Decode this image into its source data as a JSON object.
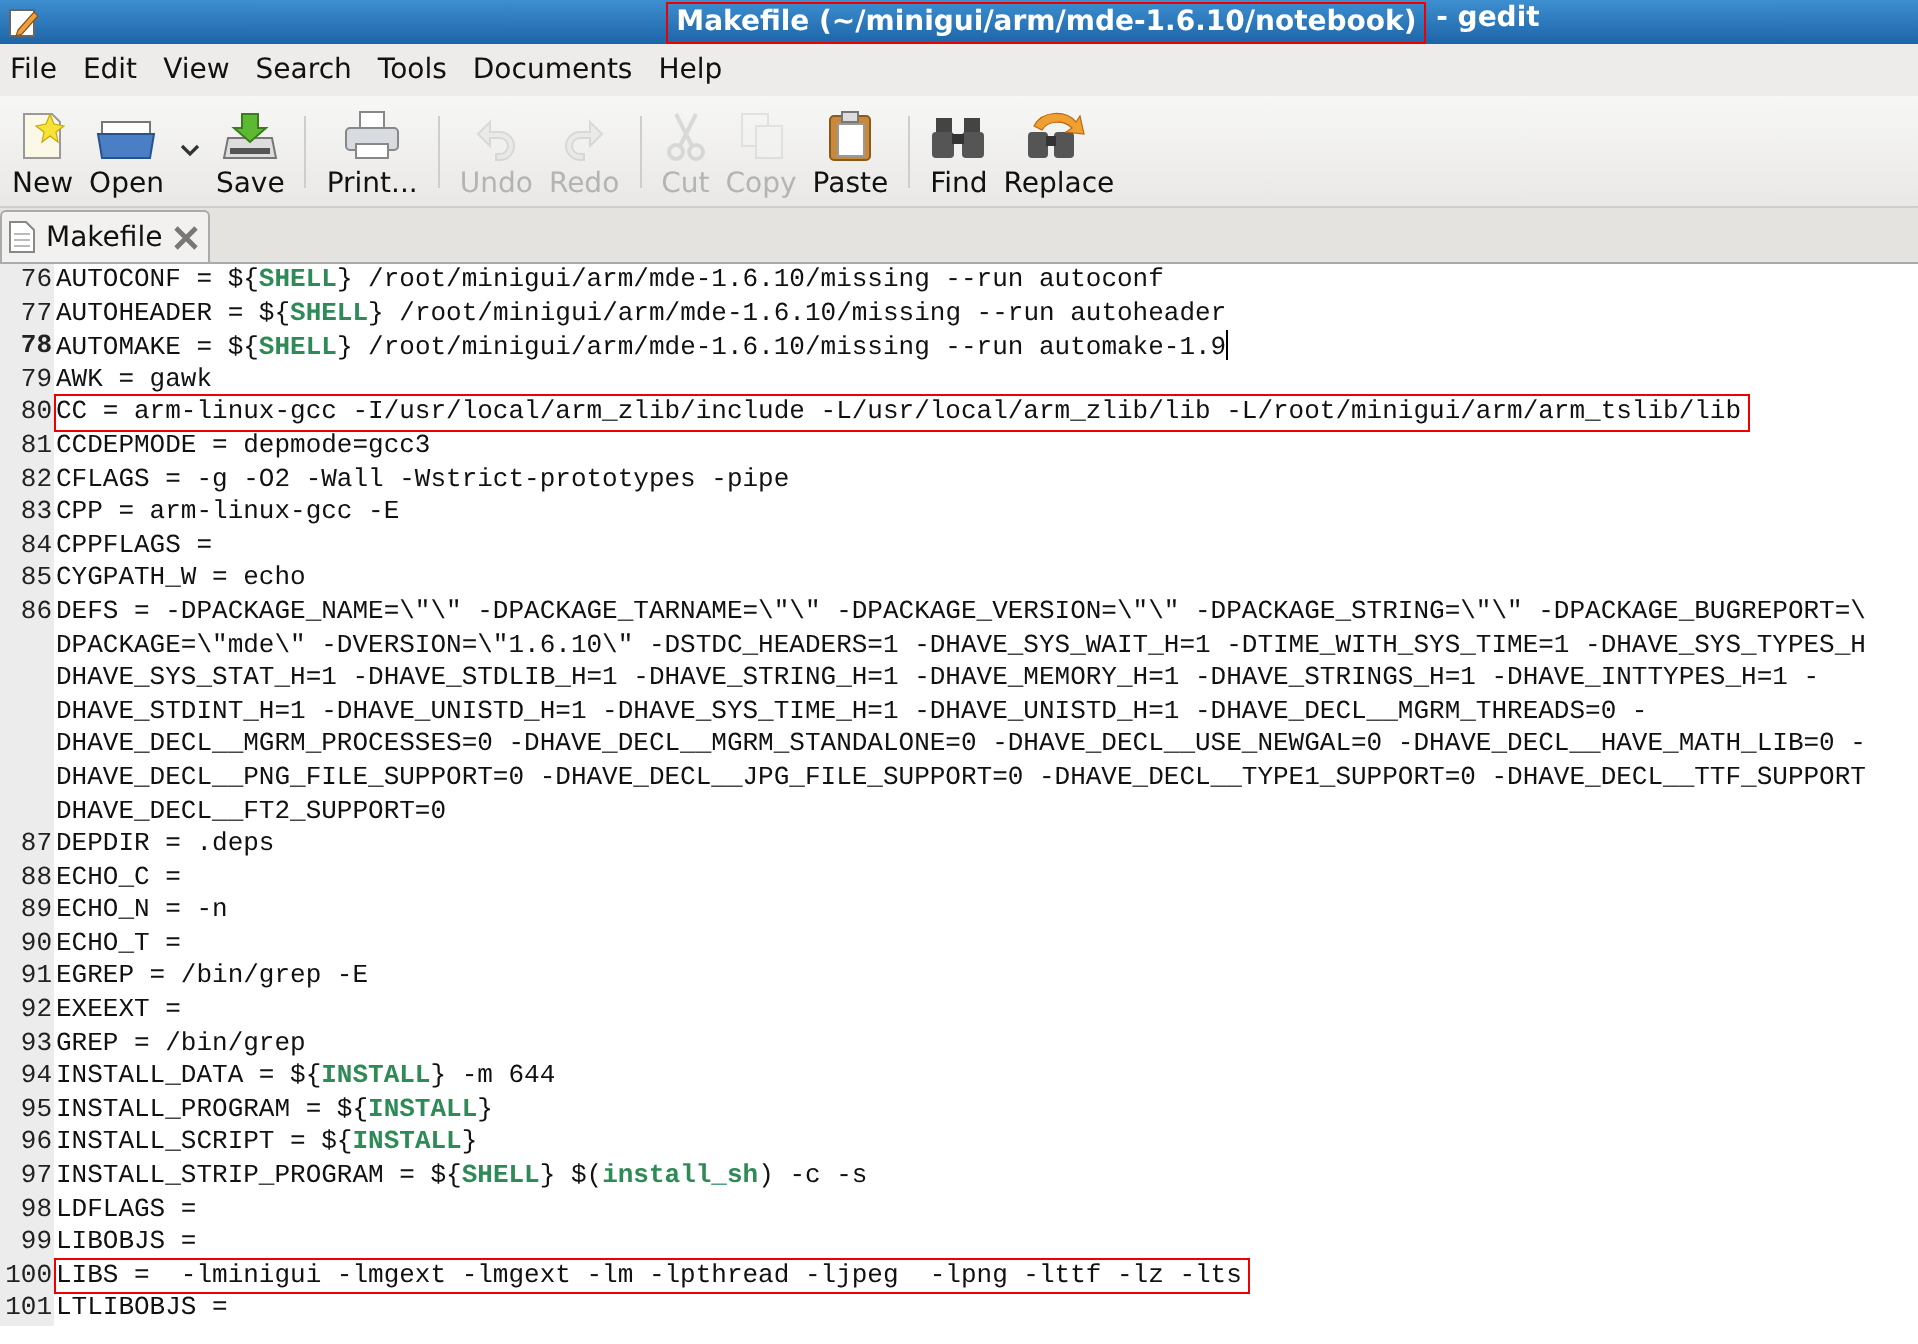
{
  "window": {
    "title": {
      "document": "Makefile (~/minigui/arm/mde-1.6.10/notebook)",
      "app": "- gedit",
      "annotated": true
    }
  },
  "menu": [
    "File",
    "Edit",
    "View",
    "Search",
    "Tools",
    "Documents",
    "Help"
  ],
  "toolbar": [
    {
      "label": "New",
      "kind": "new",
      "disabled": false
    },
    {
      "label": "Open",
      "kind": "open",
      "disabled": false
    },
    {
      "kind": "dropdown",
      "disabled": false
    },
    {
      "label": "Save",
      "kind": "save",
      "disabled": false
    },
    {
      "kind": "separator"
    },
    {
      "label": "Print...",
      "kind": "print",
      "disabled": false
    },
    {
      "kind": "separator"
    },
    {
      "label": "Undo",
      "kind": "undo",
      "disabled": true
    },
    {
      "label": "Redo",
      "kind": "redo",
      "disabled": true
    },
    {
      "kind": "separator"
    },
    {
      "label": "Cut",
      "kind": "cut",
      "disabled": true
    },
    {
      "label": "Copy",
      "kind": "copy",
      "disabled": true
    },
    {
      "label": "Paste",
      "kind": "paste",
      "disabled": false
    },
    {
      "kind": "separator"
    },
    {
      "label": "Find",
      "kind": "find",
      "disabled": false
    },
    {
      "label": "Replace",
      "kind": "replace",
      "disabled": false
    }
  ],
  "tabs": [
    {
      "label": "Makefile",
      "selected": true
    }
  ],
  "editor": {
    "lines": [
      {
        "number": "76",
        "current": false,
        "annotated": false,
        "parts": [
          {
            "text": "AUTOCONF = ${"
          },
          {
            "text": "SHELL",
            "kind": "variable"
          },
          {
            "text": "} /root/minigui/arm/mde-1.6.10/missing --run autoconf"
          }
        ]
      },
      {
        "number": "77",
        "current": false,
        "annotated": false,
        "parts": [
          {
            "text": "AUTOHEADER = ${"
          },
          {
            "text": "SHELL",
            "kind": "variable"
          },
          {
            "text": "} /root/minigui/arm/mde-1.6.10/missing --run autoheader"
          }
        ]
      },
      {
        "number": "78",
        "current": true,
        "annotated": false,
        "parts": [
          {
            "text": "AUTOMAKE = ${"
          },
          {
            "text": "SHELL",
            "kind": "variable"
          },
          {
            "text": "} /root/minigui/arm/mde-1.6.10/missing --run automake-1.9"
          }
        ]
      },
      {
        "number": "79",
        "current": false,
        "annotated": false,
        "parts": [
          {
            "text": "AWK = gawk"
          }
        ]
      },
      {
        "number": "80",
        "current": false,
        "annotated": true,
        "parts": [
          {
            "text": "CC = arm-linux-gcc -I/usr/local/arm_zlib/include -L/usr/local/arm_zlib/lib -L/root/minigui/arm/arm_tslib/lib"
          }
        ]
      },
      {
        "number": "81",
        "current": false,
        "annotated": false,
        "parts": [
          {
            "text": "CCDEPMODE = depmode=gcc3"
          }
        ]
      },
      {
        "number": "82",
        "current": false,
        "annotated": false,
        "parts": [
          {
            "text": "CFLAGS = -g -O2 -Wall -Wstrict-prototypes -pipe"
          }
        ]
      },
      {
        "number": "83",
        "current": false,
        "annotated": false,
        "parts": [
          {
            "text": "CPP = arm-linux-gcc -E"
          }
        ]
      },
      {
        "number": "84",
        "current": false,
        "annotated": false,
        "parts": [
          {
            "text": "CPPFLAGS ="
          }
        ]
      },
      {
        "number": "85",
        "current": false,
        "annotated": false,
        "parts": [
          {
            "text": "CYGPATH_W = echo"
          }
        ]
      },
      {
        "number": "86",
        "current": false,
        "annotated": false,
        "parts": [
          {
            "text": "DEFS = -DPACKAGE_NAME=\\\"\\\" -DPACKAGE_TARNAME=\\\"\\\" -DPACKAGE_VERSION=\\\"\\\" -DPACKAGE_STRING=\\\"\\\" -DPACKAGE_BUGREPORT=\\"
          }
        ],
        "continued": [
          "DPACKAGE=\\\"mde\\\" -DVERSION=\\\"1.6.10\\\" -DSTDC_HEADERS=1 -DHAVE_SYS_WAIT_H=1 -DTIME_WITH_SYS_TIME=1 -DHAVE_SYS_TYPES_H",
          "DHAVE_SYS_STAT_H=1 -DHAVE_STDLIB_H=1 -DHAVE_STRING_H=1 -DHAVE_MEMORY_H=1 -DHAVE_STRINGS_H=1 -DHAVE_INTTYPES_H=1 -",
          "DHAVE_STDINT_H=1 -DHAVE_UNISTD_H=1 -DHAVE_SYS_TIME_H=1 -DHAVE_UNISTD_H=1 -DHAVE_DECL__MGRM_THREADS=0 -",
          "DHAVE_DECL__MGRM_PROCESSES=0 -DHAVE_DECL__MGRM_STANDALONE=0 -DHAVE_DECL__USE_NEWGAL=0 -DHAVE_DECL__HAVE_MATH_LIB=0 -",
          "DHAVE_DECL__PNG_FILE_SUPPORT=0 -DHAVE_DECL__JPG_FILE_SUPPORT=0 -DHAVE_DECL__TYPE1_SUPPORT=0 -DHAVE_DECL__TTF_SUPPORT",
          "DHAVE_DECL__FT2_SUPPORT=0"
        ]
      },
      {
        "number": "87",
        "current": false,
        "annotated": false,
        "parts": [
          {
            "text": "DEPDIR = .deps"
          }
        ]
      },
      {
        "number": "88",
        "current": false,
        "annotated": false,
        "parts": [
          {
            "text": "ECHO_C ="
          }
        ]
      },
      {
        "number": "89",
        "current": false,
        "annotated": false,
        "parts": [
          {
            "text": "ECHO_N = -n"
          }
        ]
      },
      {
        "number": "90",
        "current": false,
        "annotated": false,
        "parts": [
          {
            "text": "ECHO_T ="
          }
        ]
      },
      {
        "number": "91",
        "current": false,
        "annotated": false,
        "parts": [
          {
            "text": "EGREP = /bin/grep -E"
          }
        ]
      },
      {
        "number": "92",
        "current": false,
        "annotated": false,
        "parts": [
          {
            "text": "EXEEXT ="
          }
        ]
      },
      {
        "number": "93",
        "current": false,
        "annotated": false,
        "parts": [
          {
            "text": "GREP = /bin/grep"
          }
        ]
      },
      {
        "number": "94",
        "current": false,
        "annotated": false,
        "parts": [
          {
            "text": "INSTALL_DATA = ${"
          },
          {
            "text": "INSTALL",
            "kind": "variable"
          },
          {
            "text": "} -m 644"
          }
        ]
      },
      {
        "number": "95",
        "current": false,
        "annotated": false,
        "parts": [
          {
            "text": "INSTALL_PROGRAM = ${"
          },
          {
            "text": "INSTALL",
            "kind": "variable"
          },
          {
            "text": "}"
          }
        ]
      },
      {
        "number": "96",
        "current": false,
        "annotated": false,
        "parts": [
          {
            "text": "INSTALL_SCRIPT = ${"
          },
          {
            "text": "INSTALL",
            "kind": "variable"
          },
          {
            "text": "}"
          }
        ]
      },
      {
        "number": "97",
        "current": false,
        "annotated": false,
        "parts": [
          {
            "text": "INSTALL_STRIP_PROGRAM = ${"
          },
          {
            "text": "SHELL",
            "kind": "variable"
          },
          {
            "text": "} $("
          },
          {
            "text": "install_sh",
            "kind": "variable"
          },
          {
            "text": ") -c -s"
          }
        ]
      },
      {
        "number": "98",
        "current": false,
        "annotated": false,
        "parts": [
          {
            "text": "LDFLAGS ="
          }
        ]
      },
      {
        "number": "99",
        "current": false,
        "annotated": false,
        "parts": [
          {
            "text": "LIBOBJS ="
          }
        ]
      },
      {
        "number": "100",
        "current": false,
        "annotated": true,
        "parts": [
          {
            "text": "LIBS =  -lminigui -lmgext -lmgext -lm -lpthread -ljpeg  -lpng -lttf -lz -lts"
          }
        ]
      },
      {
        "number": "101",
        "current": false,
        "annotated": false,
        "parts": [
          {
            "text": "LTLIBOBJS ="
          }
        ]
      }
    ]
  }
}
